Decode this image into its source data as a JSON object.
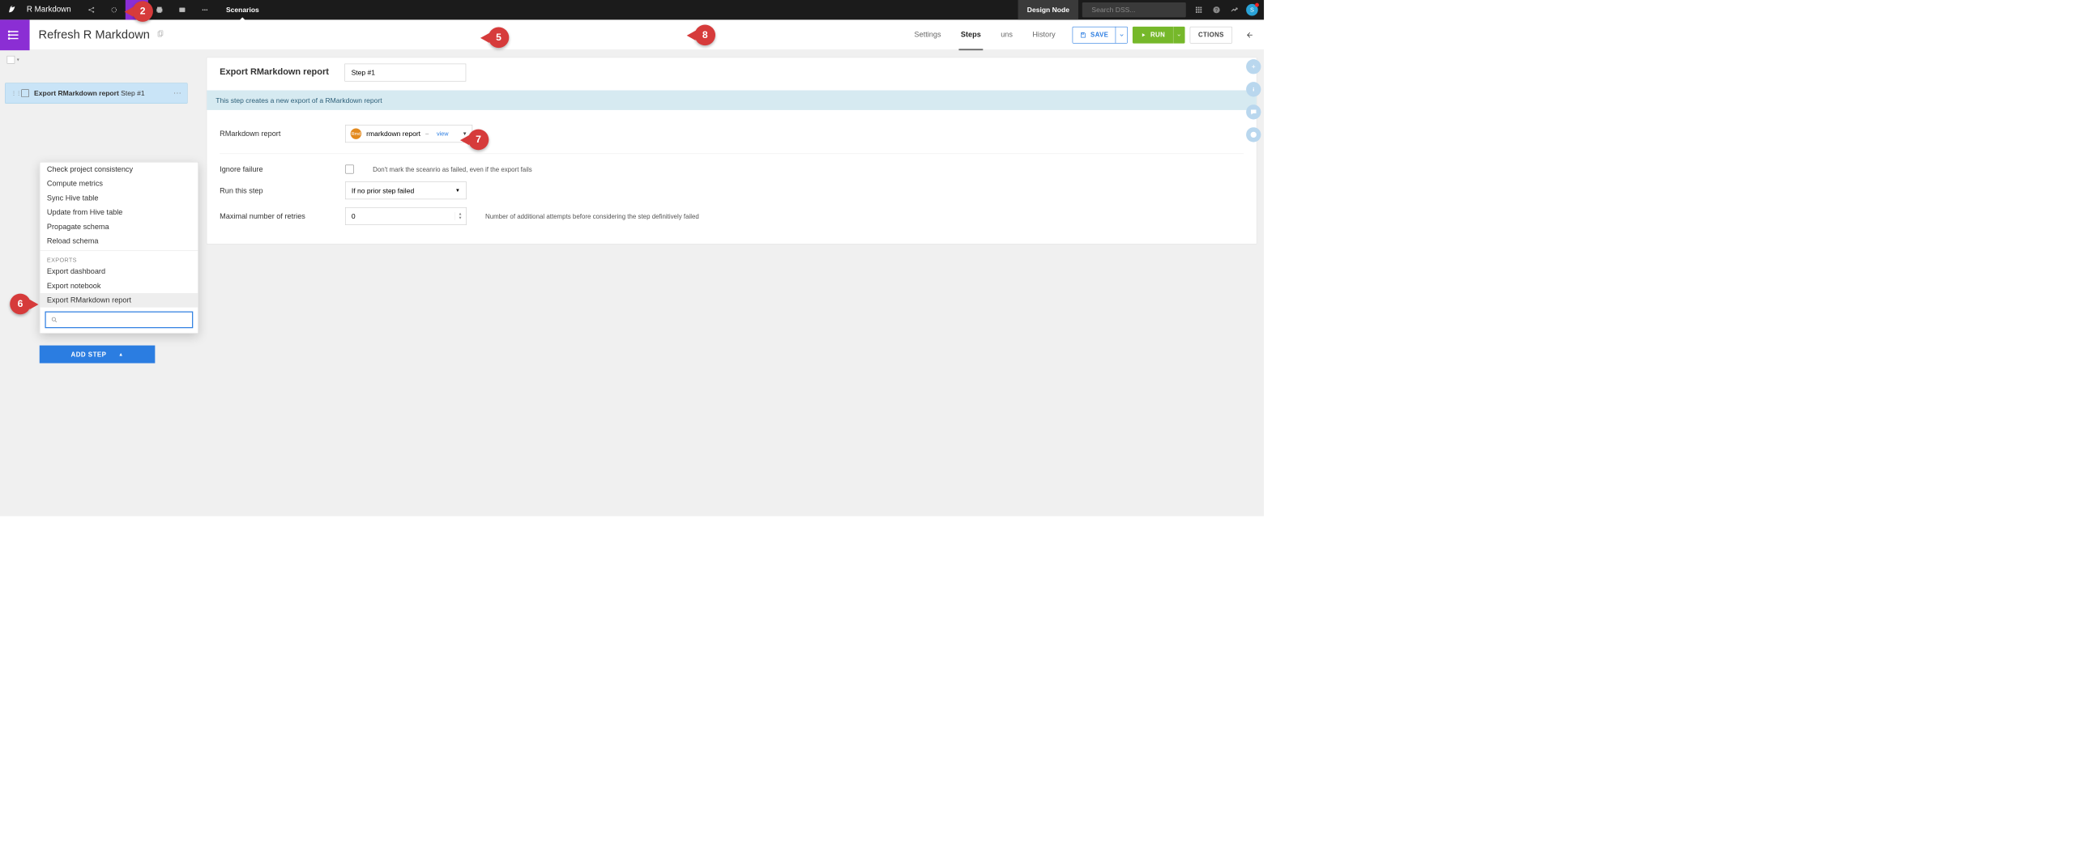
{
  "topbar": {
    "project_name": "R Markdown",
    "active_tab": "Scenarios",
    "design_node": "Design Node",
    "search_placeholder": "Search DSS...",
    "avatar_initial": "S"
  },
  "subheader": {
    "title": "Refresh R Markdown",
    "tabs": {
      "settings": "Settings",
      "steps": "Steps",
      "runs": "uns",
      "history": "History"
    },
    "save_label": "SAVE",
    "run_label": "RUN",
    "actions_label": "CTIONS"
  },
  "left": {
    "step_list": [
      {
        "title": "Export RMarkdown report",
        "suffix": " Step #1"
      }
    ],
    "add_step_label": "ADD STEP"
  },
  "step_menu": {
    "items_top": [
      "Check project consistency",
      "Compute metrics",
      "Sync Hive table",
      "Update from Hive table",
      "Propagate schema",
      "Reload schema"
    ],
    "group_label": "EXPORTS",
    "items_exports": [
      "Export dashboard",
      "Export notebook",
      "Export RMarkdown report"
    ],
    "highlight_index": 2,
    "search_value": ""
  },
  "panel": {
    "heading": "Export RMarkdown report",
    "step_name_value": "Step #1",
    "info_text": "This step creates a new export of a RMarkdown report",
    "rmd_label": "RMarkdown report",
    "rmd_selected_name": "rmarkdown report",
    "rmd_view_prefix": "– ",
    "rmd_view_link": "view",
    "ignore_failure_label": "Ignore failure",
    "ignore_failure_help": "Don't mark the sceanrio as failed, even if the export fails",
    "run_this_step_label": "Run this step",
    "run_this_step_value": "If no prior step failed",
    "retries_label": "Maximal number of retries",
    "retries_value": "0",
    "retries_help": "Number of additional attempts before considering the step definitively failed"
  },
  "badges": {
    "b2": "2",
    "b5": "5",
    "b6": "6",
    "b7": "7",
    "b8": "8"
  }
}
